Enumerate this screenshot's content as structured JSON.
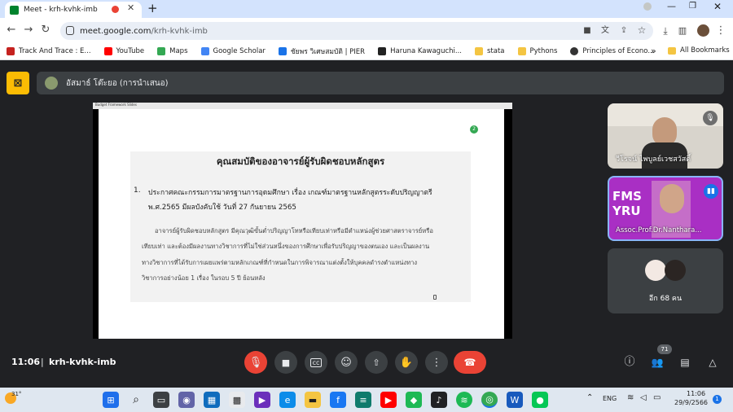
{
  "browser": {
    "tab_title": "Meet - krh-kvhk-imb",
    "new_tab": "+",
    "url_host": "meet.google.com",
    "url_path": "/krh-kvhk-imb",
    "bookmarks": [
      {
        "label": "Track And Trace : E...",
        "color": "#c5221f"
      },
      {
        "label": "YouTube",
        "color": "#ff0000"
      },
      {
        "label": "Maps",
        "color": "#34a853"
      },
      {
        "label": "Google Scholar",
        "color": "#4285f4"
      },
      {
        "label": "ชัยพร วิเศษสมบัติ | PIER",
        "color": "#1a73e8"
      },
      {
        "label": "Haruna Kawaguchi...",
        "color": "#222222"
      },
      {
        "label": "stata",
        "color": "#f4c542"
      },
      {
        "label": "Pythons",
        "color": "#f4c542"
      },
      {
        "label": "Principles of Econo...",
        "color": "#333333"
      }
    ],
    "more_bookmarks": "»",
    "all_bookmarks": "All Bookmarks"
  },
  "meet": {
    "presenter": "อัสมาธ์ โต๊ะยอ (การนำเสนอ)",
    "slide": {
      "window_tab": "Budget Framework Slides",
      "badge": "2",
      "title": "คุณสมบัติของอาจารย์ผู้รับผิดชอบหลักสูตร",
      "item_number": "1.",
      "item_line1": "ประกาศคณะกรรมการมาตรฐานการอุดมศึกษา เรื่อง เกณฑ์มาตรฐานหลักสูตรระดับปริญญาตรี",
      "item_line2": "พ.ศ.2565 มีผลบังคับใช้ วันที่ 27 กันยายน 2565",
      "para": [
        "อาจารย์ผู้รับผิดชอบหลักสูตร มีคุณวุฒิขั้นต่ำปริญญาโทหรือเทียบเท่าหรือมีตำแหน่งผู้ช่วยศาสตราจารย์หรือ",
        "เทียบเท่า และต้องมีผลงานทางวิชาการที่ไม่ใช่ส่วนหนึ่งของการศึกษาเพื่อรับปริญญาของตนเอง และเป็นผลงาน",
        "ทางวิชาการที่ได้รับการเผยแพร่ตามหลักเกณฑ์ที่กำหนดในการพิจารณาแต่งตั้งให้บุคคลดำรงตำแหน่งทาง",
        "วิชาการอย่างน้อย 1 เรื่อง ในรอบ 5 ปี ย้อนหลัง"
      ]
    },
    "participants": [
      {
        "name": "วีโรจน์ ไพบูลย์เวชสวัสดิ์"
      },
      {
        "name": "Assoc.Prof.Dr.Nanthara...",
        "banner": "FMS YRU"
      },
      {
        "name": "อีก 68 คน"
      }
    ],
    "time": "11:06",
    "meeting_code": "krh-kvhk-imb",
    "people_count": "71",
    "colors": {
      "end_call": "#ea4335",
      "mic_off": "#ea4335",
      "accent": "#8ab4f8"
    }
  },
  "taskbar": {
    "weather": "31°",
    "lang": "ENG",
    "clock_time": "11:06",
    "clock_date": "29/9/2566",
    "notif": "1"
  }
}
